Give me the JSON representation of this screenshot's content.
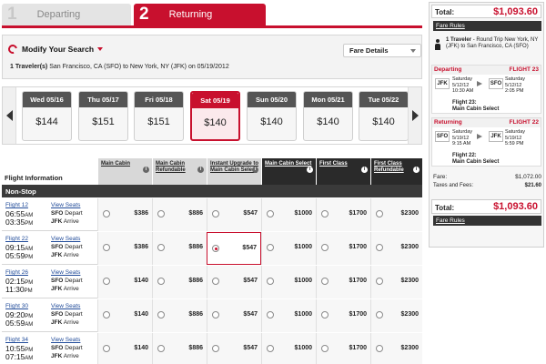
{
  "steps": [
    {
      "num": "1",
      "label": "Departing"
    },
    {
      "num": "2",
      "label": "Returning"
    }
  ],
  "search": {
    "modify_label": "Modify Your Search",
    "fare_details_label": "Fare Details",
    "travelers_label": "1 Traveler(s)",
    "route_text": "San Francisco, CA (SFO) to New York, NY (JFK) on 05/19/2012"
  },
  "dates": [
    {
      "label": "Wed 05/16",
      "price": "$144"
    },
    {
      "label": "Thu 05/17",
      "price": "$151"
    },
    {
      "label": "Fri 05/18",
      "price": "$151"
    },
    {
      "label": "Sat 05/19",
      "price": "$140"
    },
    {
      "label": "Sun 05/20",
      "price": "$140"
    },
    {
      "label": "Mon 05/21",
      "price": "$140"
    },
    {
      "label": "Tue 05/22",
      "price": "$140"
    }
  ],
  "selected_date_index": 3,
  "table": {
    "flight_info_label": "Flight Information",
    "nonstop_label": "Non-Stop",
    "columns": [
      {
        "label": "Main Cabin",
        "style": "light"
      },
      {
        "label": "Main Cabin Refundable",
        "style": "light"
      },
      {
        "label": "Instant Upgrade to Main Cabin Select",
        "style": "light"
      },
      {
        "label": "Main Cabin Select",
        "style": "dark"
      },
      {
        "label": "First Class",
        "style": "dark"
      },
      {
        "label": "First Class Refundable",
        "style": "dark"
      }
    ],
    "rows": [
      {
        "flight": "Flight 12",
        "dep_time": "06:55",
        "dep_ampm": "AM",
        "arr_time": "03:35",
        "arr_ampm": "PM",
        "seats": "View Seats",
        "dep_code": "SFO",
        "dep_word": "Depart",
        "arr_code": "JFK",
        "arr_word": "Arrive",
        "prices": [
          "$386",
          "$886",
          "$547",
          "$1000",
          "$1700",
          "$2300"
        ],
        "selected": -1
      },
      {
        "flight": "Flight 22",
        "dep_time": "09:15",
        "dep_ampm": "AM",
        "arr_time": "05:59",
        "arr_ampm": "PM",
        "seats": "View Seats",
        "dep_code": "SFO",
        "dep_word": "Depart",
        "arr_code": "JFK",
        "arr_word": "Arrive",
        "prices": [
          "$386",
          "$886",
          "$547",
          "$1000",
          "$1700",
          "$2300"
        ],
        "selected": 2
      },
      {
        "flight": "Flight 26",
        "dep_time": "02:15",
        "dep_ampm": "PM",
        "arr_time": "11:30",
        "arr_ampm": "PM",
        "seats": "View Seats",
        "dep_code": "SFO",
        "dep_word": "Depart",
        "arr_code": "JFK",
        "arr_word": "Arrive",
        "prices": [
          "$140",
          "$886",
          "$547",
          "$1000",
          "$1700",
          "$2300"
        ],
        "selected": -1
      },
      {
        "flight": "Flight 30",
        "dep_time": "09:20",
        "dep_ampm": "PM",
        "arr_time": "05:59",
        "arr_ampm": "AM",
        "seats": "View Seats",
        "dep_code": "SFO",
        "dep_word": "Depart",
        "arr_code": "JFK",
        "arr_word": "Arrive",
        "prices": [
          "$140",
          "$886",
          "$547",
          "$1000",
          "$1700",
          "$2300"
        ],
        "selected": -1
      },
      {
        "flight": "Flight 34",
        "dep_time": "10:55",
        "dep_ampm": "PM",
        "arr_time": "07:15",
        "arr_ampm": "AM",
        "seats": "View Seats",
        "dep_code": "SFO",
        "dep_word": "Depart",
        "arr_code": "JFK",
        "arr_word": "Arrive",
        "prices": [
          "$140",
          "$886",
          "$547",
          "$1000",
          "$1700",
          "$2300"
        ],
        "selected": -1
      }
    ]
  },
  "summary": {
    "total_label": "Total:",
    "total_value": "$1,093.60",
    "fare_rules": "Fare Rules",
    "traveler_bold": "1 Traveler",
    "traveler_text": " - Round Trip New York, NY (JFK) to San Francisco, CA (SFO)",
    "departing": {
      "title": "Departing",
      "flight": "FLIGHT 23",
      "from": "JFK",
      "to": "SFO",
      "dep_day": "Saturday",
      "dep_date": "5/12/12",
      "dep_time": "10:30 AM",
      "arr_day": "Saturday",
      "arr_date": "5/12/12",
      "arr_time": "2:05 PM",
      "flight_line": "Flight 23:",
      "cabin": "Main Cabin Select"
    },
    "returning": {
      "title": "Returning",
      "flight": "FLIGHT 22",
      "from": "SFO",
      "to": "JFK",
      "dep_day": "Saturday",
      "dep_date": "5/19/12",
      "dep_time": "9:15 AM",
      "arr_day": "Saturday",
      "arr_date": "5/19/12",
      "arr_time": "5:59 PM",
      "flight_line": "Flight 22:",
      "cabin": "Main Cabin Select"
    },
    "fare_label": "Fare:",
    "fare_value": "$1,072.00",
    "taxes_label": "Taxes and Fees:",
    "taxes_value": "$21.60"
  }
}
